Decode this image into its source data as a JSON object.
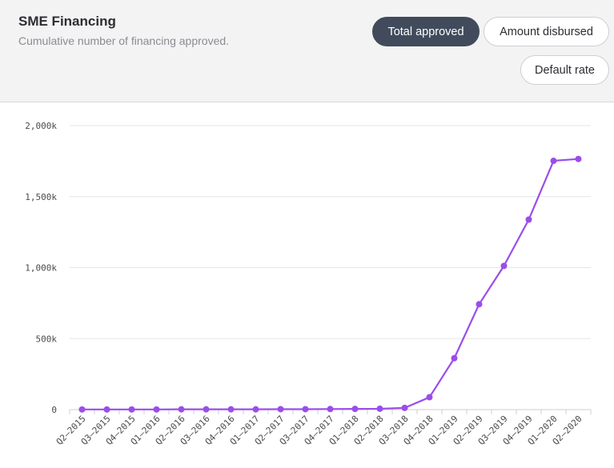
{
  "header": {
    "title": "SME Financing",
    "subtitle": "Cumulative number of financing approved."
  },
  "buttons": {
    "total_approved": "Total approved",
    "amount_disbursed": "Amount disbursed",
    "default_rate": "Default rate"
  },
  "colors": {
    "line": "#9b4dea",
    "active_button": "#414b5c",
    "header_bg": "#f3f3f4",
    "grid": "#e6e6e8"
  },
  "chart_data": {
    "type": "line",
    "categories": [
      "Q2–2015",
      "Q3–2015",
      "Q4–2015",
      "Q1–2016",
      "Q2–2016",
      "Q3–2016",
      "Q4–2016",
      "Q1–2017",
      "Q2–2017",
      "Q3–2017",
      "Q4–2017",
      "Q1–2018",
      "Q2–2018",
      "Q3–2018",
      "Q4–2018",
      "Q1–2019",
      "Q2–2019",
      "Q3–2019",
      "Q4–2019",
      "Q1–2020",
      "Q2–2020"
    ],
    "series": [
      {
        "values": [
          1,
          1,
          1,
          1,
          2,
          2,
          2,
          2,
          3,
          3,
          4,
          5,
          6,
          12,
          87,
          362,
          742,
          1012,
          1338,
          1752,
          1765
        ]
      }
    ],
    "yticks": [
      0,
      500,
      1000,
      1500,
      2000
    ],
    "ytick_labels": [
      "0",
      "500k",
      "1,000k",
      "1,500k",
      "2,000k"
    ],
    "ylim": [
      0,
      2000
    ],
    "xlabel": "",
    "ylabel": "",
    "grid": true,
    "legend": "none"
  }
}
